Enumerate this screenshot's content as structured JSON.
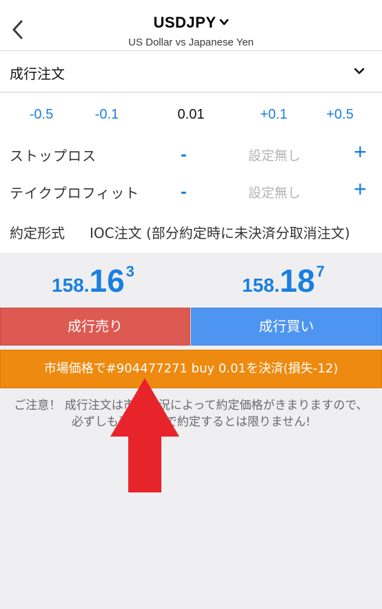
{
  "header": {
    "title": "USDJPY",
    "subtitle": "US Dollar vs Japanese Yen"
  },
  "order_type": {
    "label": "成行注文"
  },
  "volume": {
    "minus_large": "-0.5",
    "minus_small": "-0.1",
    "value": "0.01",
    "plus_small": "+0.1",
    "plus_large": "+0.5"
  },
  "stop_loss": {
    "label": "ストップロス",
    "minus": "-",
    "value": "設定無し",
    "plus": "+"
  },
  "take_profit": {
    "label": "テイクプロフィット",
    "minus": "-",
    "value": "設定無し",
    "plus": "+"
  },
  "fill_policy": {
    "label": "約定形式",
    "value": "IOC注文 (部分約定時に未決済分取消注文)"
  },
  "prices": {
    "bid": {
      "prefix": "158.",
      "big": "16",
      "sup": "3"
    },
    "ask": {
      "prefix": "158.",
      "big": "18",
      "sup": "7"
    }
  },
  "actions": {
    "sell_label": "成行売り",
    "buy_label": "成行買い",
    "close_label": "市場価格で#904477271 buy 0.01を決済(損失-12)"
  },
  "notice": "ご注意！ 成行注文は市場状況によって約定価格がきまりますので、必ずしも表示価格で約定するとは限りません!",
  "colors": {
    "accent": "#1a7fe0",
    "sell": "#dd5a52",
    "buy": "#4e95f1",
    "close": "#ee8a0f",
    "annotation_arrow": "#e8242b"
  }
}
